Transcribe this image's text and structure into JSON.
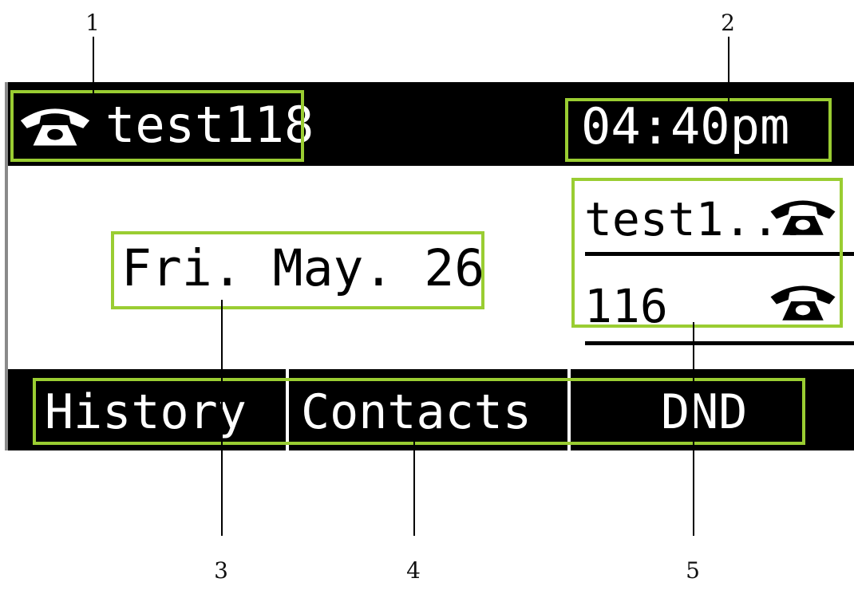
{
  "callouts": [
    "1",
    "2",
    "3",
    "4",
    "5"
  ],
  "header": {
    "account_name": "test118",
    "time": "04:40pm",
    "phone_icon": "phone-handset-icon"
  },
  "main": {
    "date": "Fri. May. 26",
    "lines": [
      {
        "label": "test1...",
        "icon": "phone-handset-icon"
      },
      {
        "label": "116",
        "icon": "phone-handset-icon"
      }
    ]
  },
  "softkeys": [
    "History",
    "Contacts",
    "DND"
  ],
  "colors": {
    "highlight": "#9acd32",
    "lcd_background": "#000000",
    "lcd_foreground": "#ffffff"
  }
}
